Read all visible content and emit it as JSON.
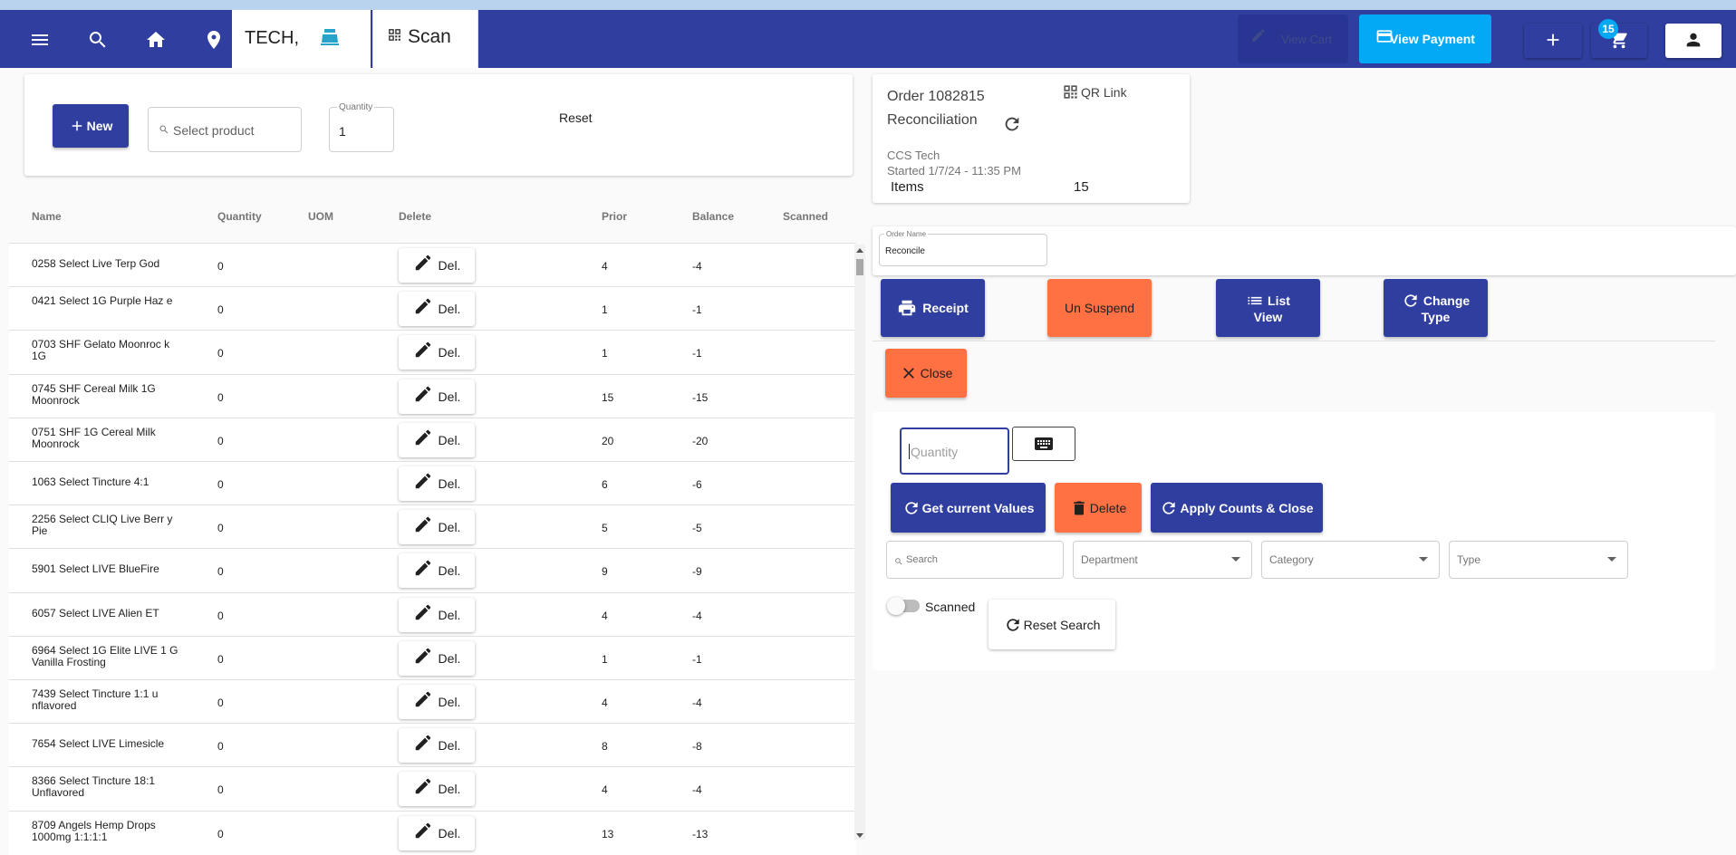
{
  "nav": {
    "location": "TECH,",
    "scan_label": "Scan",
    "view_cart_label": "View Cart",
    "view_payment_label": "View Payment",
    "cart_count": "15",
    "colors": {
      "navbar": "#303f9f",
      "accent_blue": "#03a9f4",
      "orange": "#ff7043"
    }
  },
  "add_bar": {
    "new_label": "New",
    "product_placeholder": "Select product",
    "quantity_label": "Quantity",
    "quantity_value": "1",
    "reset_label": "Reset"
  },
  "table": {
    "headers": [
      "Name",
      "Quantity",
      "UOM",
      "Delete",
      "Prior",
      "Balance",
      "Scanned"
    ],
    "del_label": "Del.",
    "rows": [
      {
        "name": "0258 Select Live Terp God",
        "qty": "0",
        "prior": "4",
        "balance": "-4"
      },
      {
        "name": "0421 Select 1G Purple Haz e",
        "qty": "0",
        "prior": "1",
        "balance": "-1"
      },
      {
        "name": "0703 SHF Gelato Moonroc k 1G",
        "qty": "0",
        "prior": "1",
        "balance": "-1"
      },
      {
        "name": "0745 SHF Cereal Milk 1G Moonrock",
        "qty": "0",
        "prior": "15",
        "balance": "-15"
      },
      {
        "name": "0751 SHF 1G Cereal Milk Moonrock",
        "qty": "0",
        "prior": "20",
        "balance": "-20"
      },
      {
        "name": "1063 Select Tincture 4:1",
        "qty": "0",
        "prior": "6",
        "balance": "-6"
      },
      {
        "name": "2256 Select CLIQ Live Berr y Pie",
        "qty": "0",
        "prior": "5",
        "balance": "-5"
      },
      {
        "name": "5901 Select LIVE BlueFire",
        "qty": "0",
        "prior": "9",
        "balance": "-9"
      },
      {
        "name": "6057 Select LIVE Alien ET",
        "qty": "0",
        "prior": "4",
        "balance": "-4"
      },
      {
        "name": "6964 Select 1G Elite LIVE 1 G Vanilla Frosting",
        "qty": "0",
        "prior": "1",
        "balance": "-1"
      },
      {
        "name": "7439 Select Tincture 1:1 u nflavored",
        "qty": "0",
        "prior": "4",
        "balance": "-4"
      },
      {
        "name": "7654 Select LIVE Limesicle",
        "qty": "0",
        "prior": "8",
        "balance": "-8"
      },
      {
        "name": "8366 Select Tincture 18:1 Unflavored",
        "qty": "0",
        "prior": "4",
        "balance": "-4"
      },
      {
        "name": "8709 Angels Hemp Drops 1000mg 1:1:1:1",
        "qty": "0",
        "prior": "13",
        "balance": "-13"
      }
    ]
  },
  "order": {
    "title": "Order 1082815",
    "qr_label": "QR Link",
    "type": "Reconciliation",
    "company": "CCS Tech",
    "started": "Started 1/7/24 - 11:35 PM",
    "items_label": "Items",
    "items_count": "15",
    "name_label": "Order Name",
    "name_value": "Reconcile"
  },
  "actions": {
    "receipt": "Receipt",
    "unsuspend": "Un Suspend",
    "list_view_1": "List",
    "list_view_2": "View",
    "change_type_1": "Change",
    "change_type_2": "Type",
    "close": "Close"
  },
  "recon": {
    "quantity_placeholder": "Quantity",
    "get_values": "Get current Values",
    "delete": "Delete",
    "apply": "Apply Counts & Close",
    "search_placeholder": "Search",
    "department": "Department",
    "category": "Category",
    "type": "Type",
    "scanned": "Scanned",
    "reset_search": "Reset Search"
  }
}
